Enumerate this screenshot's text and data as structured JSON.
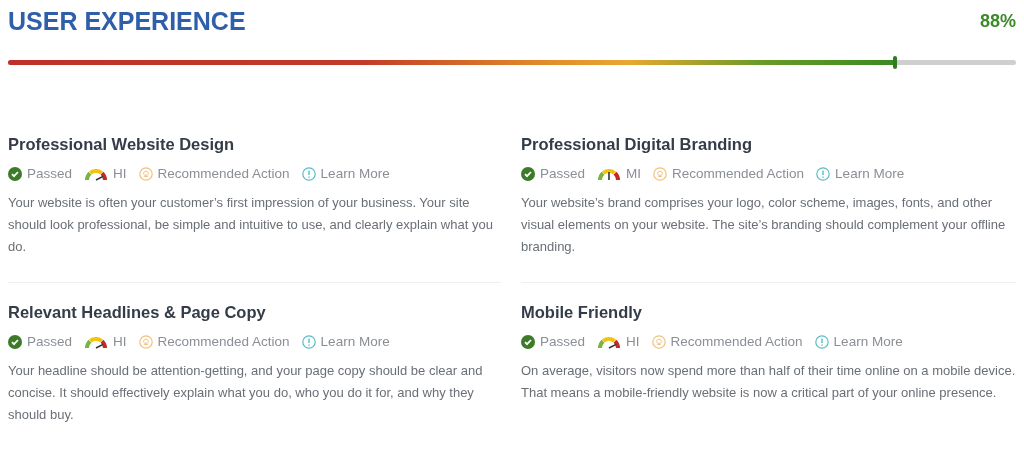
{
  "header": {
    "title": "USER EXPERIENCE",
    "score": "88%",
    "level": 0.88
  },
  "items": [
    {
      "title": "Professional Website Design",
      "passed": true,
      "status": "Passed",
      "impact": {
        "label": "HI",
        "kind": "high"
      },
      "action": "Recommended Action",
      "learn": "Learn More",
      "text": "Your website is often your customer’s first impression of your business. Your site should look professional, be simple and intuitive to use, and clearly explain what you do."
    },
    {
      "title": "Professional Digital Branding",
      "passed": true,
      "status": "Passed",
      "impact": {
        "label": "MI",
        "kind": "medium"
      },
      "action": "Recommended Action",
      "learn": "Learn More",
      "text": "Your website’s brand comprises your logo, color scheme, images, fonts, and other visual elements on your website. The site’s branding should complement your offline branding."
    },
    {
      "title": "Relevant Headlines & Page Copy",
      "passed": true,
      "status": "Passed",
      "impact": {
        "label": "HI",
        "kind": "high"
      },
      "action": "Recommended Action",
      "learn": "Learn More",
      "text": "Your headline should be attention-getting, and your page copy should be clear and concise. It should effectively explain what you do, who you do it for, and why they should buy."
    },
    {
      "title": "Mobile Friendly",
      "passed": true,
      "status": "Passed",
      "impact": {
        "label": "HI",
        "kind": "high"
      },
      "action": "Recommended Action",
      "learn": "Learn More",
      "text": "On average, visitors now spend more than half of their time online on a mobile device. That means a mobile-friendly website is now a critical part of your online presence."
    }
  ]
}
